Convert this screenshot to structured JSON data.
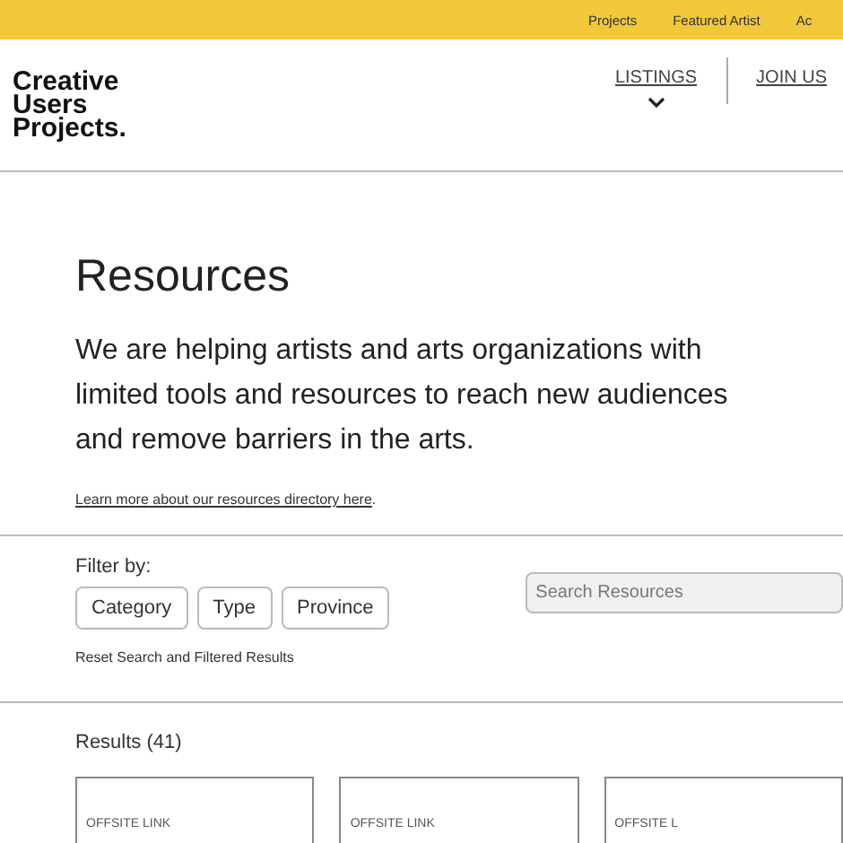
{
  "top_bar": {
    "links": [
      "Projects",
      "Featured Artist",
      "Ac"
    ]
  },
  "header": {
    "logo": [
      "Creative",
      "Users",
      "Projects."
    ],
    "nav": [
      {
        "label": "LISTINGS",
        "has_dropdown": true
      },
      {
        "label": "JOIN US",
        "has_dropdown": false
      }
    ]
  },
  "intro": {
    "title": "Resources",
    "text": "We are helping artists and arts organizations with limited tools and resources to reach new audiences and remove barriers in the arts.",
    "link": "Learn more about our resources directory here",
    "link_end": "."
  },
  "filters": {
    "label": "Filter by:",
    "buttons": [
      "Category",
      "Type",
      "Province"
    ],
    "reset": "Reset Search and Filtered Results",
    "search": {
      "placeholder": "Search Resources"
    }
  },
  "results": {
    "heading": "Results (41)",
    "cards": [
      {
        "tag": "OFFSITE LINK"
      },
      {
        "tag": "OFFSITE LINK"
      },
      {
        "tag": "OFFSITE L"
      }
    ]
  }
}
